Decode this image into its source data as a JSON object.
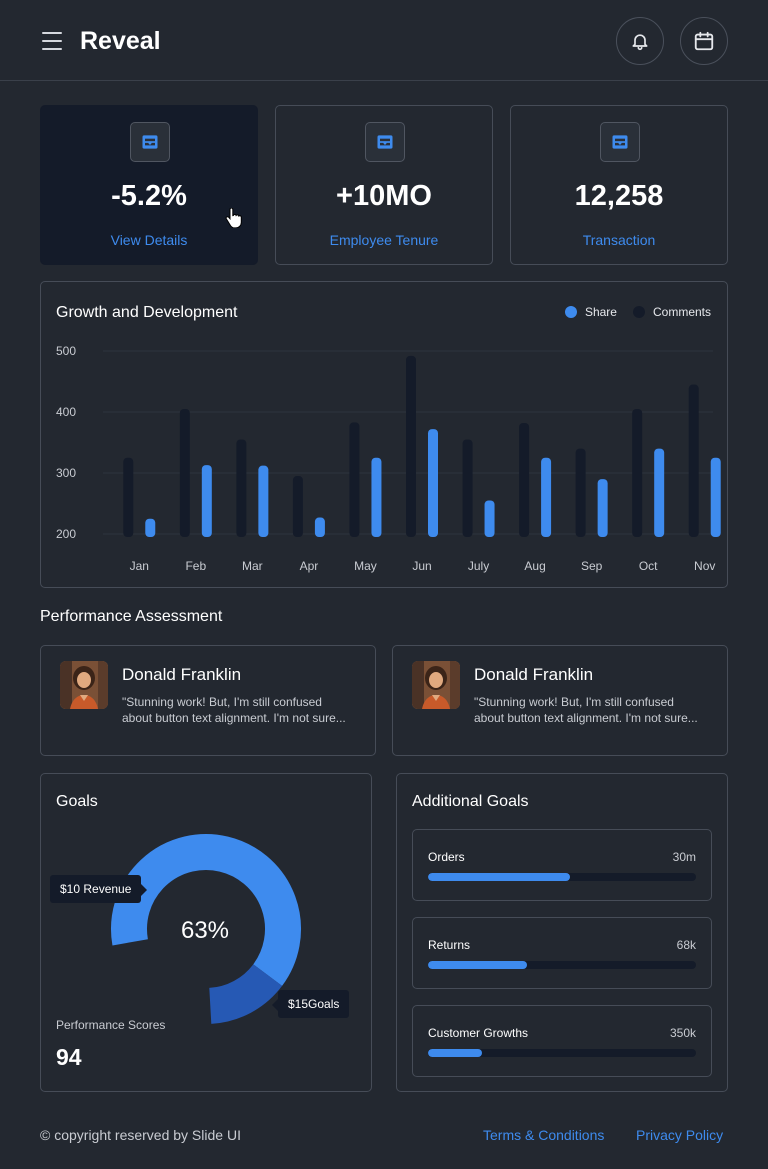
{
  "header": {
    "brand": "Reveal"
  },
  "stats": [
    {
      "value": "-5.2%",
      "link": "View Details"
    },
    {
      "value": "+10MO",
      "link": "Employee Tenure"
    },
    {
      "value": "12,258",
      "link": "Transaction"
    }
  ],
  "growth": {
    "title": "Growth and Development",
    "legend": {
      "share": "Share",
      "comments": "Comments"
    }
  },
  "chart_data": {
    "type": "bar",
    "title": "Growth and Development",
    "categories": [
      "Jan",
      "Feb",
      "Mar",
      "Apr",
      "May",
      "Jun",
      "July",
      "Aug",
      "Sep",
      "Oct",
      "Nov"
    ],
    "series": [
      {
        "name": "Comments",
        "color": "#141b29",
        "values": [
          325,
          405,
          355,
          295,
          383,
          492,
          355,
          382,
          340,
          405,
          445
        ]
      },
      {
        "name": "Share",
        "color": "#3e8bee",
        "values": [
          225,
          313,
          312,
          227,
          325,
          372,
          255,
          325,
          290,
          340,
          325
        ]
      }
    ],
    "yticks": [
      "500",
      "400",
      "300",
      "200"
    ],
    "ylim": [
      200,
      500
    ],
    "grid": true,
    "legend_position": "top-right"
  },
  "performance": {
    "title": "Performance Assessment",
    "reviews": [
      {
        "name": "Donald Franklin",
        "text": "\"Stunning work! But, I'm still confused about button text alignment. I'm not sure..."
      },
      {
        "name": "Donald Franklin",
        "text": "\"Stunning work! But, I'm still confused about button text alignment. I'm not sure..."
      }
    ]
  },
  "goals": {
    "title": "Goals",
    "percent": "63%",
    "percent_value": 63,
    "tooltip_revenue": "$10 Revenue",
    "tooltip_goals": "$15Goals",
    "scores_label": "Performance Scores",
    "scores_value": "94"
  },
  "additional_goals": {
    "title": "Additional Goals",
    "items": [
      {
        "label": "Orders",
        "value": "30m",
        "progress": 0.53
      },
      {
        "label": "Returns",
        "value": "68k",
        "progress": 0.37
      },
      {
        "label": "Customer Growths",
        "value": "350k",
        "progress": 0.2
      }
    ]
  },
  "footer": {
    "copyright": "© copyright reserved by Slide UI",
    "terms": "Terms & Conditions",
    "privacy": "Privacy Policy"
  },
  "colors": {
    "accent": "#3e8bee",
    "dark": "#141b29",
    "bg": "#232830",
    "arc_secondary": "#2659b4"
  }
}
